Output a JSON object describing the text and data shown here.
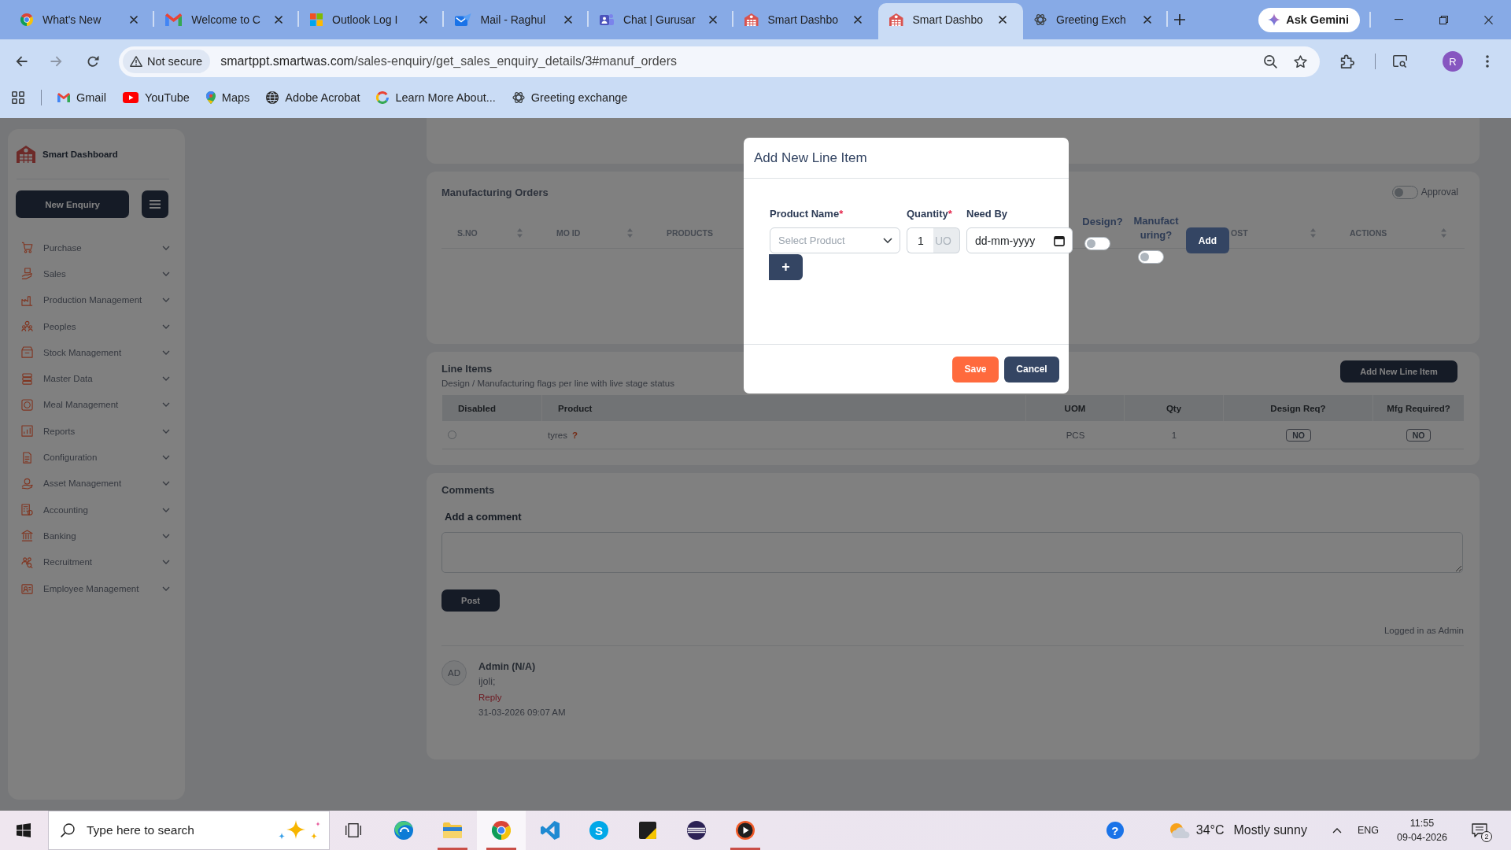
{
  "browser": {
    "tabs": [
      {
        "title": "What's New",
        "selected": false
      },
      {
        "title": "Welcome to C",
        "selected": false
      },
      {
        "title": "Outlook Log I",
        "selected": false
      },
      {
        "title": "Mail - Raghul",
        "selected": false
      },
      {
        "title": "Chat | Gurusar",
        "selected": false
      },
      {
        "title": "Smart Dashbo",
        "selected": false
      },
      {
        "title": "Smart Dashbo",
        "selected": true
      },
      {
        "title": "Greeting Exch",
        "selected": false
      }
    ],
    "assistant_button": "Ask Gemini",
    "address": {
      "security": "Not secure",
      "host": "smartppt.smartwas.com",
      "path": "/sales-enquiry/get_sales_enquiry_details/3#manuf_orders"
    },
    "profile": "R",
    "bookmarks": [
      "Gmail",
      "YouTube",
      "Maps",
      "Adobe Acrobat",
      "Learn More About...",
      "Greeting exchange"
    ]
  },
  "sidebar": {
    "brand": "Smart Dashboard",
    "new_button": "New Enquiry",
    "items": [
      {
        "label": "Purchase",
        "expanded": false
      },
      {
        "label": "Sales",
        "expanded": false
      },
      {
        "label": "Production Management",
        "expanded": false
      },
      {
        "label": "Peoples",
        "expanded": false
      },
      {
        "label": "Stock Management",
        "expanded": false
      },
      {
        "label": "Master Data",
        "expanded": false
      },
      {
        "label": "Meal Management",
        "expanded": false
      },
      {
        "label": "Reports",
        "expanded": false
      },
      {
        "label": "Configuration",
        "expanded": false
      },
      {
        "label": "Asset Management",
        "expanded": false
      },
      {
        "label": "Accounting",
        "expanded": false
      },
      {
        "label": "Banking",
        "expanded": false
      },
      {
        "label": "Recruitment",
        "expanded": false
      },
      {
        "label": "Employee Management",
        "expanded": false
      }
    ]
  },
  "manufacturing_orders": {
    "title": "Manufacturing Orders",
    "approval": {
      "label": "Approval",
      "on": false
    },
    "columns": [
      {
        "label": "S.NO",
        "sortable": true
      },
      {
        "label": "MO ID",
        "sortable": true
      },
      {
        "label": "PRODUCTS",
        "sortable": false
      },
      {
        "label": "OST",
        "sortable": true
      },
      {
        "label": "ACTIONS",
        "sortable": true
      }
    ]
  },
  "line_items": {
    "title": "Line Items",
    "subtitle": "Design / Manufacturing flags per line with live stage status",
    "add_button": "Add New Line Item",
    "columns": [
      "Disabled",
      "Product",
      "UOM",
      "Qty",
      "Design Req?",
      "Mfg Required?"
    ],
    "rows": [
      {
        "checked": false,
        "product": "tyres",
        "note": "?",
        "uom": "PCS",
        "qty": "1",
        "design_req": "NO",
        "mfg_required": "NO"
      }
    ]
  },
  "comments": {
    "title": "Comments",
    "prompt": "Add a comment",
    "post_button": "Post",
    "login_note": "Logged in as Admin",
    "items": [
      {
        "initials": "AD",
        "author": "Admin (N/A)",
        "text": "ijoli;",
        "reply": "Reply",
        "time": "31-03-2026 09:07 AM"
      }
    ]
  },
  "modal": {
    "title": "Add New Line Item",
    "fields": [
      {
        "kind": "select",
        "label": "Product Name",
        "required_mark": "*",
        "placeholder": "Select Product"
      },
      {
        "kind": "quantity",
        "label": "Quantity",
        "required_mark": "*",
        "value": "1",
        "unit": "UO"
      },
      {
        "kind": "date",
        "label": "Need By",
        "placeholder": "dd-mm-yyyy"
      },
      {
        "kind": "toggle",
        "label": "Design?",
        "on": false
      },
      {
        "kind": "toggle",
        "label": "Manufacturing?",
        "on": false
      }
    ],
    "add_button": "Add",
    "add_row_button": "+",
    "buttons": [
      {
        "label": "Save",
        "kind": "primary"
      },
      {
        "label": "Cancel",
        "kind": "secondary"
      }
    ]
  },
  "taskbar": {
    "search_placeholder": "Type here to search",
    "apps": [
      {
        "running": false,
        "selected": false
      },
      {
        "running": true,
        "selected": false
      },
      {
        "running": true,
        "selected": true
      },
      {
        "running": false,
        "selected": false
      },
      {
        "glyph": "S",
        "running": false,
        "selected": false
      },
      {
        "running": false,
        "selected": false
      },
      {
        "running": false,
        "selected": false
      },
      {
        "running": true,
        "selected": false
      }
    ],
    "help": "?",
    "temperature": "34°C",
    "weather": "Mostly sunny",
    "language": "ENG",
    "time": "11:55",
    "date": "09-04-2026",
    "notifications": "2"
  }
}
